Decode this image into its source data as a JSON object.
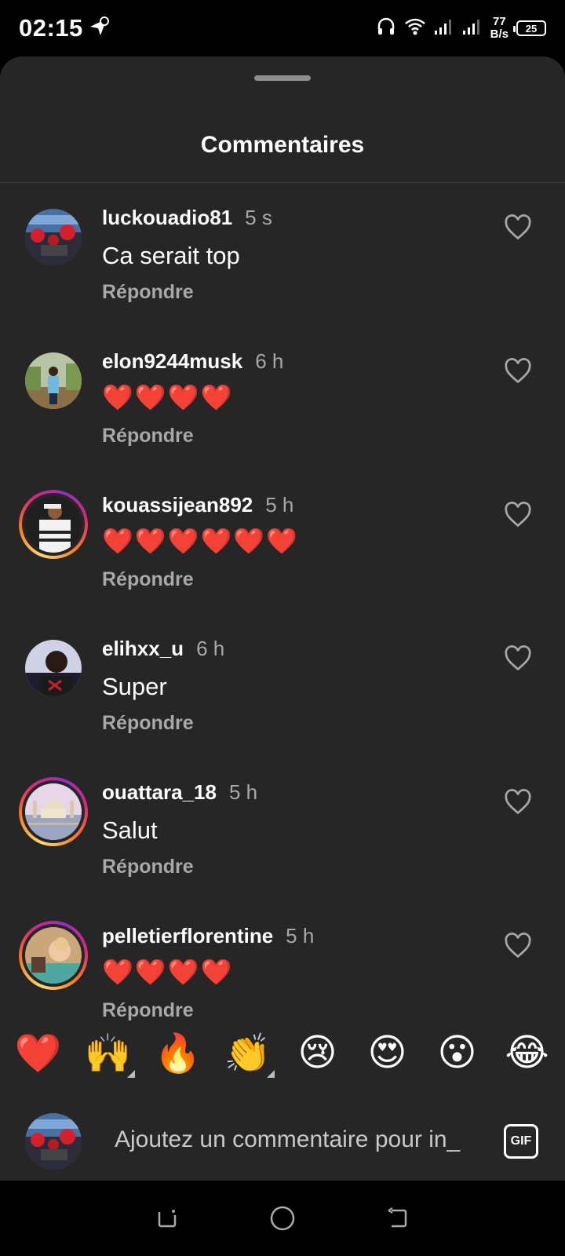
{
  "status_bar": {
    "time": "02:15",
    "net_speed_value": "77",
    "net_speed_unit": "B/s",
    "battery": "25"
  },
  "sheet": {
    "title": "Commentaires"
  },
  "comments": [
    {
      "user": "luckouadio81",
      "time": "5 s",
      "text": "Ca serait top",
      "hearts": "",
      "reply": "Répondre",
      "story": false,
      "avatar": "avatar-flowers"
    },
    {
      "user": "elon9244musk",
      "time": "6 h",
      "text": "",
      "hearts": "❤️❤️❤️❤️",
      "reply": "Répondre",
      "story": false,
      "avatar": "avatar-outdoor"
    },
    {
      "user": "kouassijean892",
      "time": "5 h",
      "text": "",
      "hearts": "❤️❤️❤️❤️❤️❤️",
      "reply": "Répondre",
      "story": true,
      "avatar": "avatar-jersey"
    },
    {
      "user": "elihxx_u",
      "time": "6 h",
      "text": "Super",
      "hearts": "",
      "reply": "Répondre",
      "story": false,
      "avatar": "avatar-spider"
    },
    {
      "user": "ouattara_18",
      "time": "5 h",
      "text": "Salut",
      "hearts": "",
      "reply": "Répondre",
      "story": true,
      "avatar": "avatar-mosque"
    },
    {
      "user": "pelletierflorentine",
      "time": "5 h",
      "text": "",
      "hearts": "❤️❤️❤️❤️",
      "reply": "Répondre",
      "story": true,
      "avatar": "avatar-child"
    }
  ],
  "emoji_bar": [
    "❤️",
    "🙌",
    "🔥",
    "👏",
    "😢",
    "😍",
    "😮",
    "😂"
  ],
  "composer": {
    "placeholder": "Ajoutez un commentaire pour in_",
    "gif_label": "GIF"
  },
  "colors": {
    "sheet_bg": "#262626",
    "secondary_text": "#a8a8a8",
    "heart_red": "#e0121f"
  }
}
